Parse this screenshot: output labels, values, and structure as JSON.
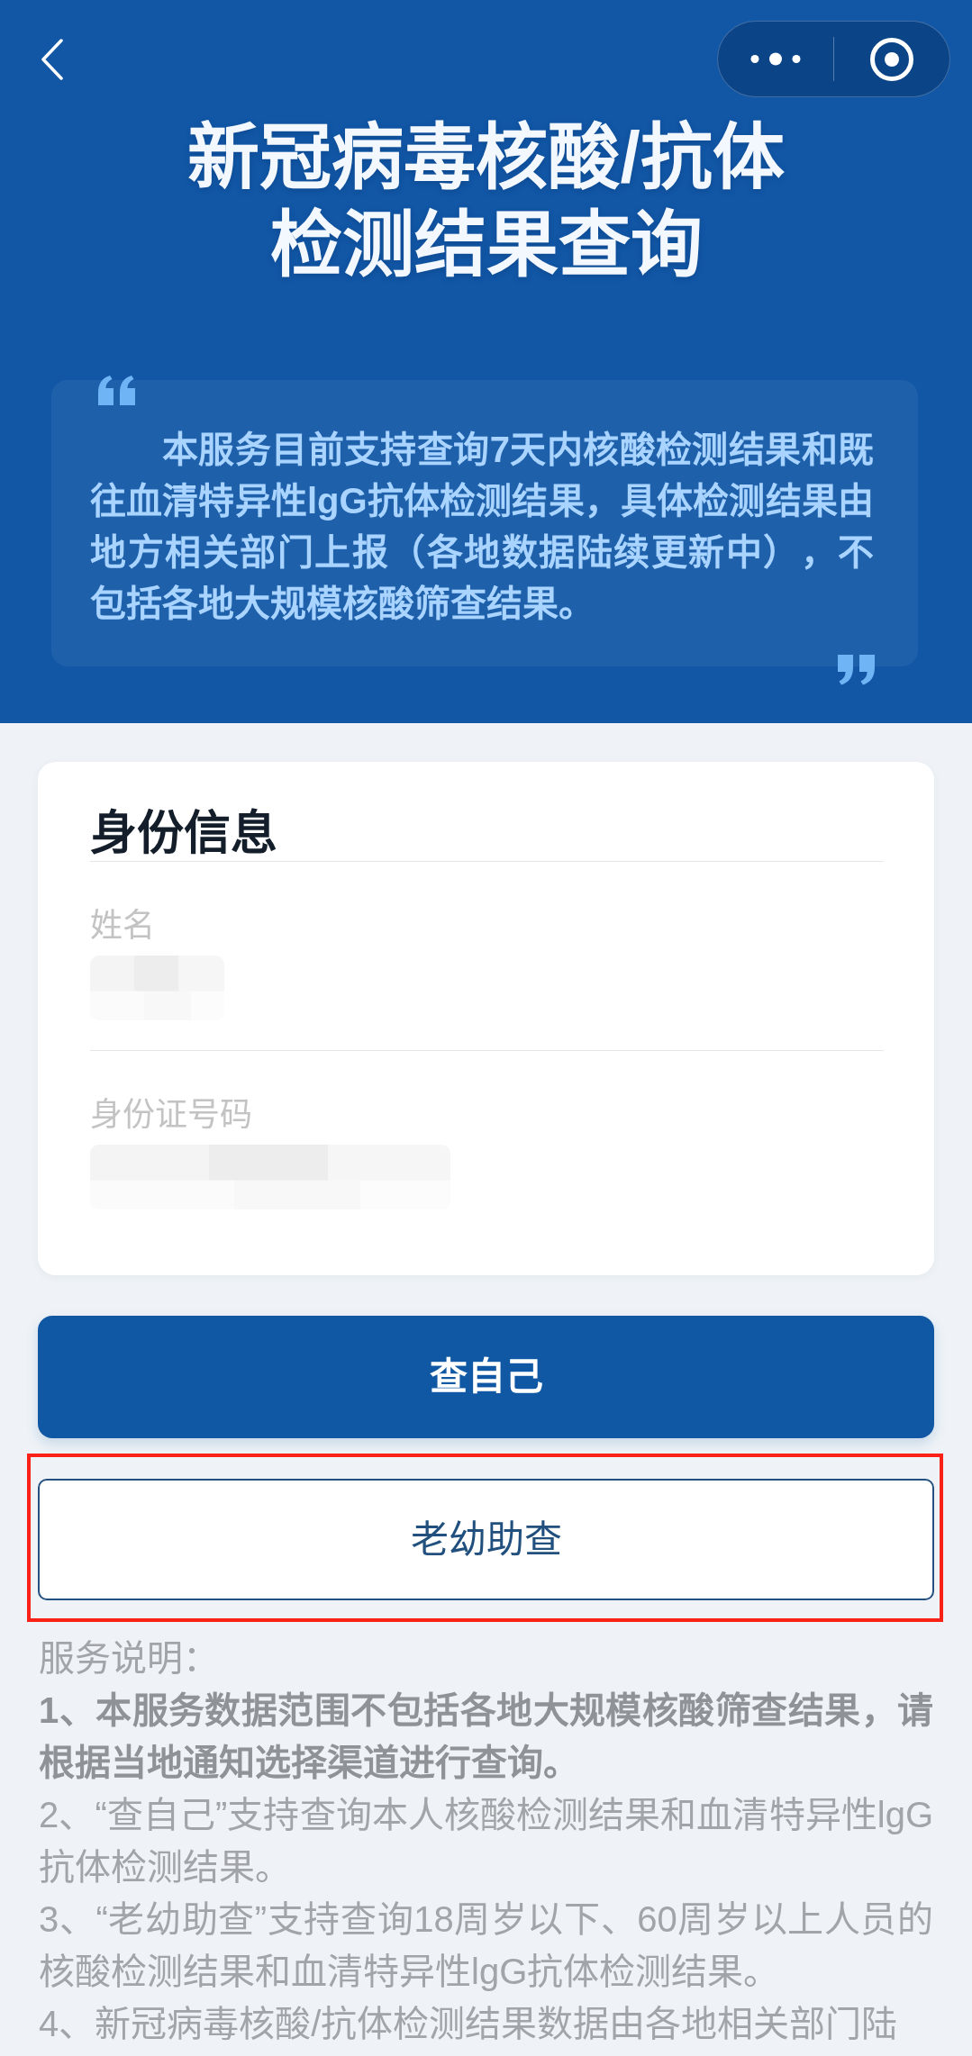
{
  "header": {
    "title": "新冠病毒核酸/抗体检测结果查询",
    "notice": "本服务目前支持查询7天内核酸检测结果和既往血清特异性lgG抗体检测结果，具体检测结果由地方相关部门上报（各地数据陆续更新中），不包括各地大规模核酸筛查结果。"
  },
  "identity": {
    "title": "身份信息",
    "fields": [
      {
        "label": "姓名",
        "kind": "name",
        "redacted": true
      },
      {
        "label": "身份证号码",
        "kind": "id_number",
        "redacted": true
      }
    ]
  },
  "buttons": [
    {
      "label": "查自己",
      "kind": "primary",
      "highlighted": false
    },
    {
      "label": "老幼助查",
      "kind": "outline",
      "highlighted": true
    }
  ],
  "service_notes": {
    "heading": "服务说明：",
    "items": [
      {
        "text": "1、本服务数据范围不包括各地大规模核酸筛查结果，请根据当地通知选择渠道进行查询。",
        "bold": true
      },
      {
        "text": "2、“查自己”支持查询本人核酸检测结果和血清特异性lgG抗体检测结果。",
        "bold": false
      },
      {
        "text": "3、“老幼助查”支持查询18周岁以下、60周岁以上人员的核酸检测结果和血清特异性lgG抗体检测结果。",
        "bold": false
      },
      {
        "text": "4、新冠病毒核酸/抗体检测结果数据由各地相关部门陆",
        "bold": false
      }
    ]
  }
}
